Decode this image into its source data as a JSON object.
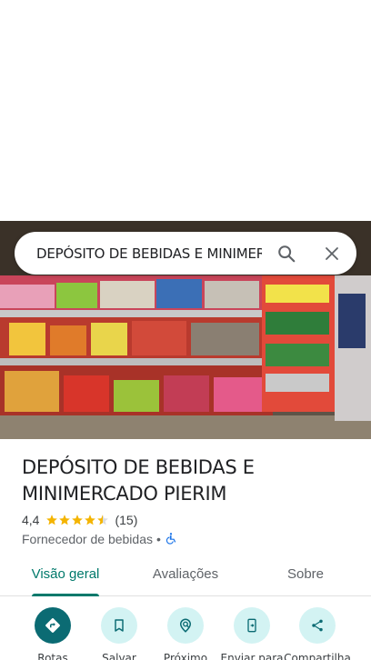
{
  "search": {
    "query": "DEPÓSITO DE BEBIDAS E MINIMERC"
  },
  "place": {
    "name": "DEPÓSITO DE BEBIDAS E MINIMERCADO PIERIM",
    "rating": "4,4",
    "stars": 4.4,
    "review_count": "(15)",
    "category": "Fornecedor de bebidas",
    "separator": "•"
  },
  "tabs": [
    {
      "label": "Visão geral",
      "active": true
    },
    {
      "label": "Avaliações",
      "active": false
    },
    {
      "label": "Sobre",
      "active": false
    }
  ],
  "actions": [
    {
      "label": "Rotas",
      "icon": "directions-icon"
    },
    {
      "label": "Salvar",
      "icon": "bookmark-icon"
    },
    {
      "label": "Próximo",
      "icon": "nearby-icon"
    },
    {
      "label": "Enviar para",
      "icon": "send-to-phone-icon"
    },
    {
      "label": "Compartilha",
      "icon": "share-icon"
    }
  ],
  "colors": {
    "accent": "#00796b",
    "action_bg": "#d3f3f3",
    "primary_action": "#0b6b73",
    "star": "#f4b400",
    "wheelchair": "#1a73e8"
  }
}
